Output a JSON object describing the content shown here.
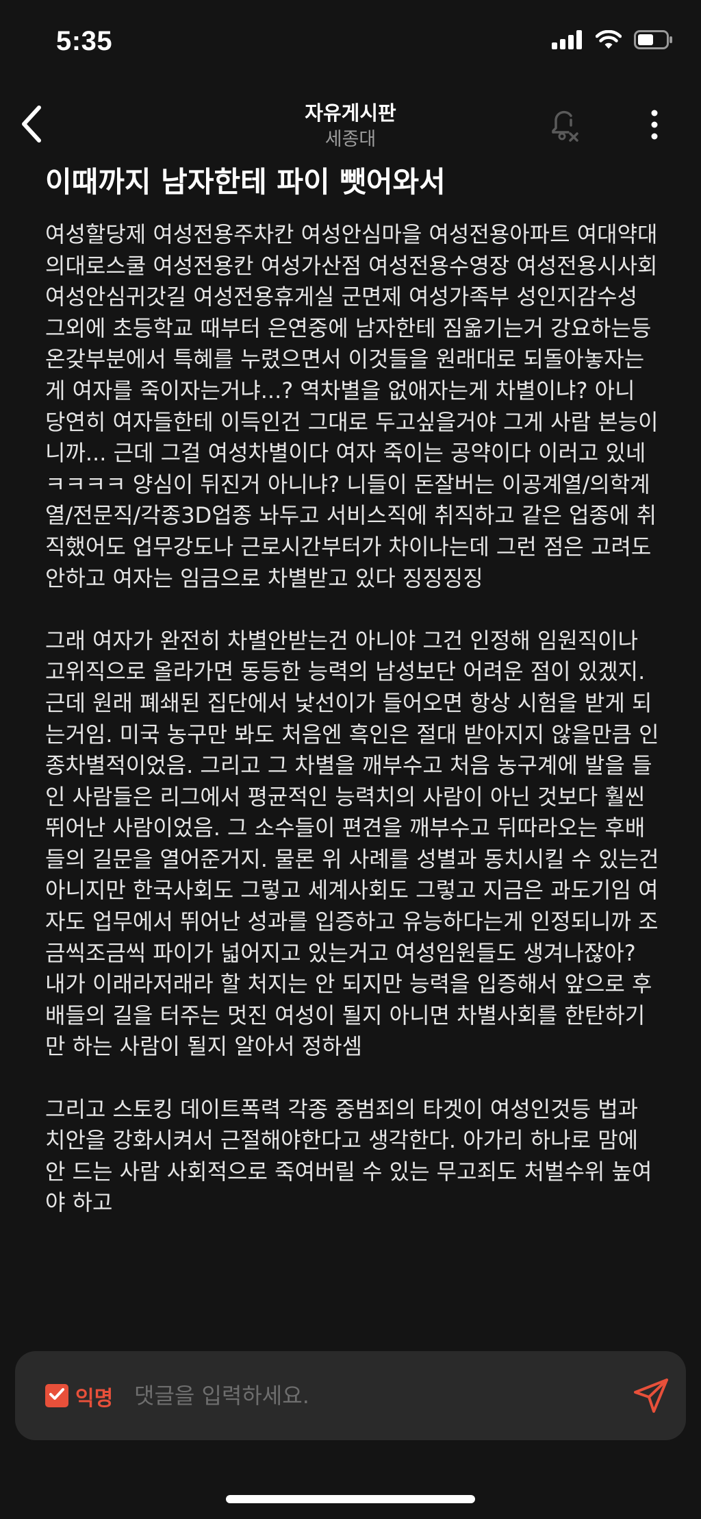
{
  "status_bar": {
    "time": "5:35"
  },
  "header": {
    "title": "자유게시판",
    "subtitle": "세종대"
  },
  "post": {
    "title": "이때까지 남자한테 파이 뺏어와서",
    "paragraphs": [
      "여성할당제 여성전용주차칸 여성안심마을 여성전용아파트 여대약대의대로스쿨 여성전용칸  여성가산점 여성전용수영장 여성전용시사회 여성안심귀갓길 여성전용휴게실 군면제 여성가족부 성인지감수성 그외에 초등학교 때부터 은연중에 남자한테 짐옮기는거 강요하는등 온갖부분에서 특혜를 누렸으면서 이것들을 원래대로 되돌아놓자는게 여자를 죽이자는거냐...? 역차별을 없애자는게 차별이냐? 아니 당연히 여자들한테 이득인건 그대로 두고싶을거야 그게 사람 본능이니까... 근데 그걸 여성차별이다 여자 죽이는 공약이다 이러고 있네 ㅋㅋㅋㅋ 양심이 뒤진거 아니냐? 니들이 돈잘버는 이공계열/의학계열/전문직/각종3D업종 놔두고 서비스직에 취직하고 같은 업종에 취직했어도 업무강도나 근로시간부터가 차이나는데 그런 점은 고려도 안하고 여자는 임금으로 차별받고 있다 징징징징",
      "그래 여자가 완전히 차별안받는건 아니야 그건 인정해 임원직이나 고위직으로 올라가면 동등한 능력의 남성보단 어려운 점이 있겠지. 근데 원래 폐쇄된 집단에서 낯선이가 들어오면 항상 시험을 받게 되는거임. 미국 농구만 봐도 처음엔 흑인은 절대 받아지지 않을만큼 인종차별적이었음. 그리고 그 차별을 깨부수고 처음 농구계에 발을 들인 사람들은 리그에서 평균적인 능력치의 사람이 아닌 것보다 훨씬 뛰어난 사람이었음. 그 소수들이 편견을 깨부수고 뒤따라오는 후배들의 길문을 열어준거지. 물론 위 사례를 성별과 동치시킬 수 있는건 아니지만 한국사회도 그렇고 세계사회도 그렇고 지금은 과도기임 여자도 업무에서 뛰어난 성과를 입증하고 유능하다는게 인정되니까 조금씩조금씩 파이가 넓어지고 있는거고 여성임원들도 생겨나잖아? 내가 이래라저래라 할 처지는 안 되지만 능력을 입증해서 앞으로 후배들의 길을 터주는 멋진 여성이 될지 아니면 차별사회를 한탄하기만 하는 사람이 될지 알아서 정하셈",
      "그리고 스토킹 데이트폭력 각종 중범죄의 타겟이 여성인것등 법과 치안을 강화시켜서 근절해야한다고 생각한다. 아가리 하나로 맘에 안 드는 사람 사회적으로 죽여버릴 수 있는 무고죄도 처벌수위 높여야 하고"
    ]
  },
  "comment_bar": {
    "anonymous_label": "익명",
    "anonymous_checked": true,
    "input_placeholder": "댓글을 입력하세요.",
    "input_value": ""
  },
  "colors": {
    "background": "#141414",
    "accent": "#e8503a",
    "text_primary": "#ffffff",
    "text_secondary": "#9c9c9c",
    "input_bg": "#2a2a2a"
  },
  "icons": {
    "back": "chevron-left-icon",
    "bell": "bell-off-icon",
    "more": "more-vertical-icon",
    "send": "send-icon",
    "checkbox": "checkbox-checked-icon",
    "signal": "cellular-signal-icon",
    "wifi": "wifi-icon",
    "battery": "battery-icon"
  }
}
